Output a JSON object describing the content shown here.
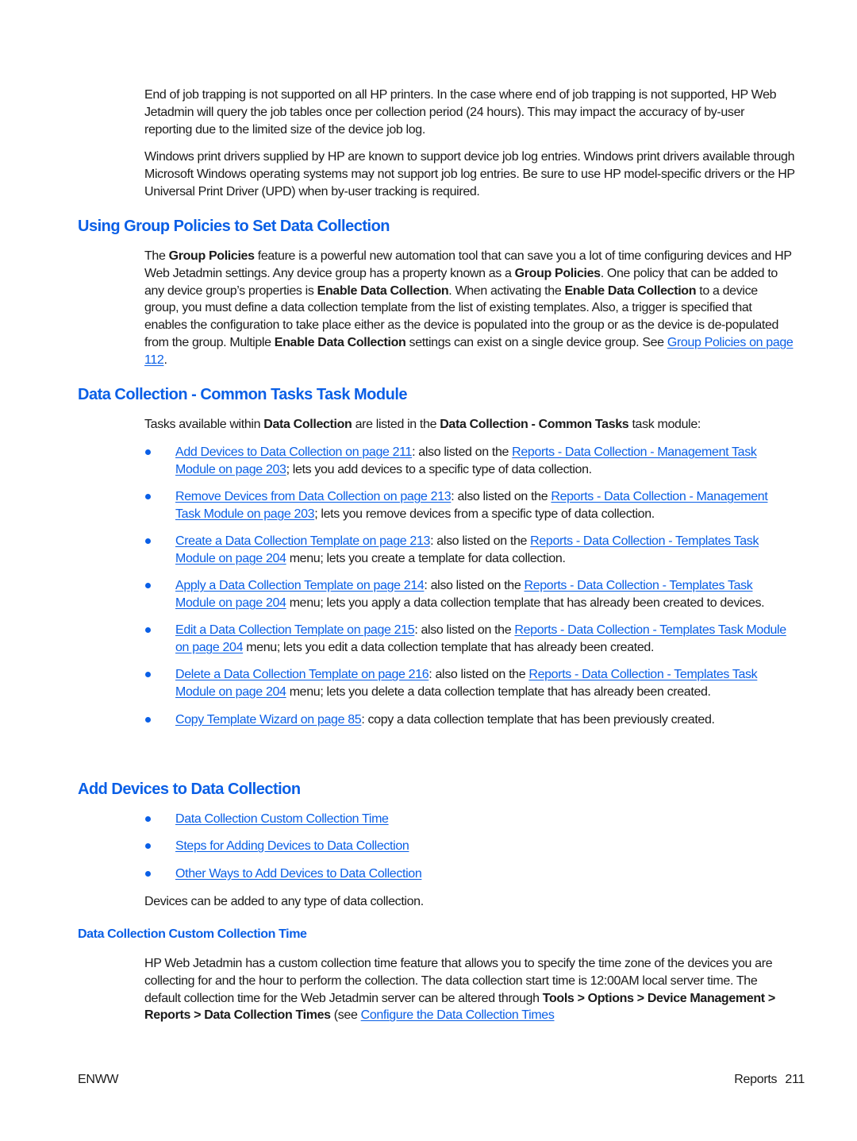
{
  "intro": {
    "para1": "End of job trapping is not supported on all HP printers. In the case where end of job trapping is not supported, HP Web Jetadmin will query the job tables once per collection period (24 hours). This may impact the accuracy of by-user reporting due to the limited size of the device job log.",
    "para2": "Windows print drivers supplied by HP are known to support device job log entries. Windows print drivers available through Microsoft Windows operating systems may not support job log entries. Be sure to use HP model-specific drivers or the HP Universal Print Driver (UPD) when by-user tracking is required."
  },
  "group_policies": {
    "heading": "Using Group Policies to Set Data Collection",
    "t1": "The ",
    "b1": "Group Policies",
    "t2": " feature is a powerful new automation tool that can save you a lot of time configuring devices and HP Web Jetadmin settings. Any device group has a property known as a ",
    "b2": "Group Policies",
    "t3": ". One policy that can be added to any device group’s properties is ",
    "b3": "Enable Data Collection",
    "t4": ". When activating the ",
    "b4": "Enable Data Collection",
    "t5": " to a device group, you must define a data collection template from the list of existing templates. Also, a trigger is specified that enables the configuration to take place either as the device is populated into the group or as the device is de-populated from the group. Multiple ",
    "b5": "Enable Data Collection",
    "t6": " settings can exist on a single device group. See ",
    "link": "Group Policies on page 112",
    "t7": "."
  },
  "common_tasks": {
    "heading": "Data Collection - Common Tasks Task Module",
    "intro_t1": "Tasks available within ",
    "intro_b1": "Data Collection",
    "intro_t2": " are listed in the ",
    "intro_b2": "Data Collection - Common Tasks",
    "intro_t3": " task module:",
    "items": [
      {
        "link1": "Add Devices to Data Collection on page 211",
        "mid": ": also listed on the ",
        "link2": "Reports - Data Collection - Management Task Module on page 203",
        "tail": "; lets you add devices to a specific type of data collection."
      },
      {
        "link1": "Remove Devices from Data Collection on page 213",
        "mid": ": also listed on the ",
        "link2": "Reports - Data Collection - Management Task Module on page 203",
        "tail": "; lets you remove devices from a specific type of data collection."
      },
      {
        "link1": "Create a Data Collection Template on page 213",
        "mid": ": also listed on the ",
        "link2": "Reports - Data Collection - Templates Task Module on page 204",
        "tail": " menu; lets you create a template for data collection."
      },
      {
        "link1": "Apply a Data Collection Template on page 214",
        "mid": ": also listed on the ",
        "link2": "Reports - Data Collection - Templates Task Module on page 204",
        "tail": " menu; lets you apply a data collection template that has already been created to devices."
      },
      {
        "link1": "Edit a Data Collection Template on page 215",
        "mid": ": also listed on the ",
        "link2": "Reports - Data Collection - Templates Task Module on page 204",
        "tail": " menu; lets you edit a data collection template that has already been created."
      },
      {
        "link1": "Delete a Data Collection Template on page 216",
        "mid": ": also listed on the ",
        "link2": "Reports - Data Collection - Templates Task Module on page 204",
        "tail": " menu; lets you delete a data collection template that has already been created."
      },
      {
        "link1": "Copy Template Wizard on page 85",
        "tail": ": copy a data collection template that has been previously created."
      }
    ]
  },
  "add_devices": {
    "heading": "Add Devices to Data Collection",
    "links": [
      "Data Collection Custom Collection Time",
      "Steps for Adding Devices to Data Collection",
      "Other Ways to Add Devices to Data Collection"
    ],
    "note": "Devices can be added to any type of data collection."
  },
  "custom_time": {
    "heading": "Data Collection Custom Collection Time",
    "t1": "HP Web Jetadmin has a custom collection time feature that allows you to specify the time zone of the devices you are collecting for and the hour to perform the collection. The data collection start time is 12:00AM local server time. The default collection time for the Web Jetadmin server can be altered through ",
    "b1": "Tools > Options > Device Management > Reports > Data Collection Times",
    "t2": " (see ",
    "link": "Configure the Data Collection Times"
  },
  "footer": {
    "left": "ENWW",
    "section": "Reports",
    "page_number": "211"
  },
  "colors": {
    "accent": "#0a5fe6",
    "text": "#1a1a1a"
  }
}
